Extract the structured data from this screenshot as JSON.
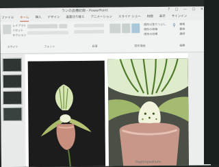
{
  "window": {
    "title": "ランの品種記録 - PowerPoint",
    "controls": "? ▢ — ▢ ✕"
  },
  "ribbon_tabs": [
    "ファイル",
    "ホーム",
    "挿入",
    "デザイン",
    "画面切り替え",
    "アニメーション",
    "スライド ショー",
    "校閲",
    "表示",
    "サインイン"
  ],
  "ribbon": {
    "left_items": [
      "レイアウト",
      "リセット",
      "セクション"
    ],
    "right_items": [
      "図形の塗りつぶし",
      "図形の枠線",
      "図形の効果"
    ],
    "edit_items": [
      "検索",
      "置換",
      "選択"
    ],
    "groups": [
      "スライド",
      "フォント",
      "段落",
      "図形描画",
      "編集"
    ]
  },
  "slide_caption": "Paphiopedilum",
  "colors": {
    "accent": "#b84a2c",
    "ribbon_bg": "#f1f3f2",
    "bezel": "#1e2523"
  },
  "icons": [
    "shapes-icon",
    "arrange-icon",
    "quick-styles-icon",
    "find-icon"
  ]
}
